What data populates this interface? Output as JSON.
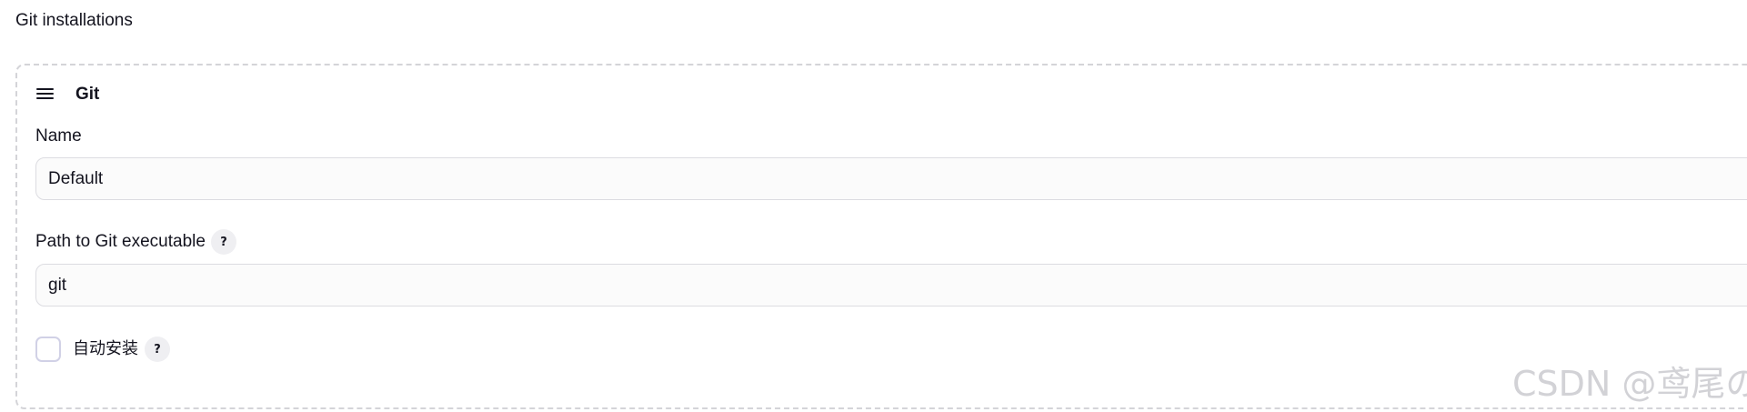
{
  "section": {
    "title": "Git installations"
  },
  "git_item": {
    "title": "Git",
    "drag_icon": "hamburger-menu-icon",
    "name_field": {
      "label": "Name",
      "value": "Default"
    },
    "path_field": {
      "label": "Path to Git executable",
      "value": "git",
      "help": "?"
    },
    "auto_install": {
      "label": "自动安装",
      "checked": false,
      "help": "?"
    }
  },
  "watermark": {
    "text": "CSDN @鸢尾の"
  },
  "colors": {
    "text": "#14141f",
    "border": "#dcdce1",
    "dashed_border": "#d4d4d8",
    "input_bg": "#fbfbfb",
    "help_bg": "#efeff2"
  }
}
